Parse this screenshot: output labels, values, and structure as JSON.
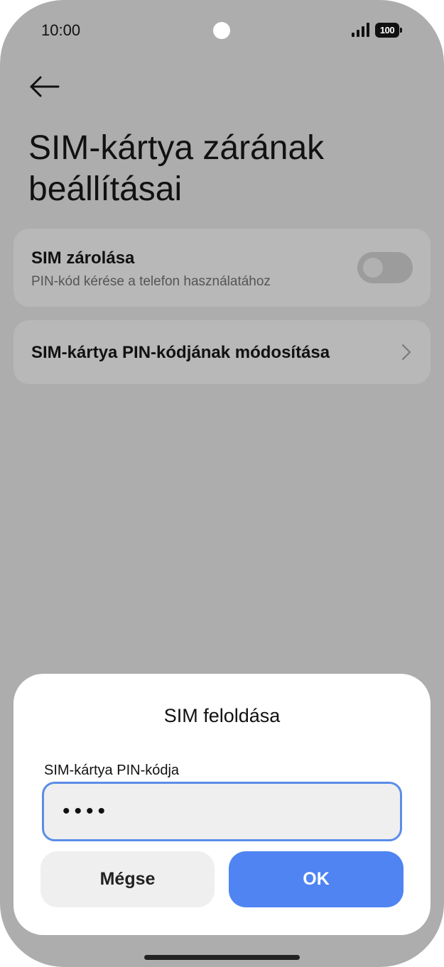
{
  "status_bar": {
    "time": "10:00",
    "battery": "100"
  },
  "header": {
    "back_icon": "arrow-left-icon",
    "title": "SIM-kártya zárának beállításai"
  },
  "settings": {
    "sim_lock": {
      "title": "SIM zárolása",
      "subtitle": "PIN-kód kérése a telefon használatához",
      "enabled": false
    },
    "change_pin": {
      "title": "SIM-kártya PIN-kódjának módosítása",
      "icon": "chevron-right-icon"
    }
  },
  "dialog": {
    "title": "SIM feloldása",
    "field_label": "SIM-kártya PIN-kódja",
    "pin_value": "••••",
    "cancel_label": "Mégse",
    "ok_label": "OK"
  },
  "colors": {
    "accent": "#4f84f2",
    "input_border": "#5a8de8",
    "scrim_background": "#adadad"
  }
}
